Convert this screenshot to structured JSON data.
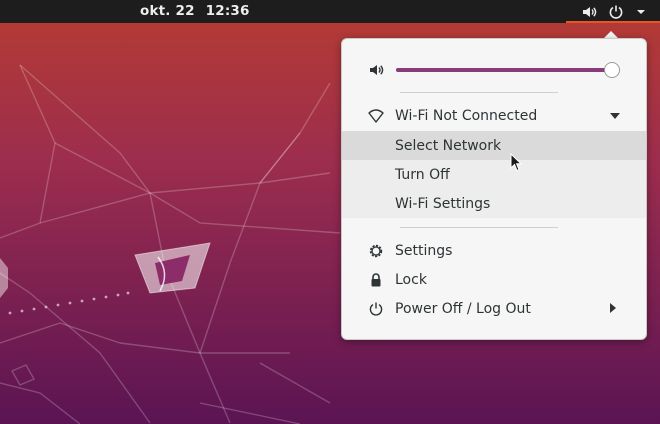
{
  "topbar": {
    "date": "okt. 22",
    "time": "12:36",
    "tray_icons": [
      "speaker-icon",
      "power-icon",
      "chevron-down-icon"
    ],
    "accent_color": "#e95420"
  },
  "menu": {
    "volume": {
      "icon": "speaker-icon",
      "level_percent": 100,
      "fill_color": "#8a3b7a"
    },
    "wifi": {
      "icon": "wifi-icon",
      "label": "Wi-Fi Not Connected",
      "expanded": true,
      "items": [
        {
          "label": "Select Network",
          "hovered": true
        },
        {
          "label": "Turn Off"
        },
        {
          "label": "Wi-Fi Settings"
        }
      ]
    },
    "settings": {
      "icon": "gear-icon",
      "label": "Settings"
    },
    "lock": {
      "icon": "lock-icon",
      "label": "Lock"
    },
    "power": {
      "icon": "power-icon",
      "label": "Power Off / Log Out",
      "has_submenu": true
    }
  }
}
